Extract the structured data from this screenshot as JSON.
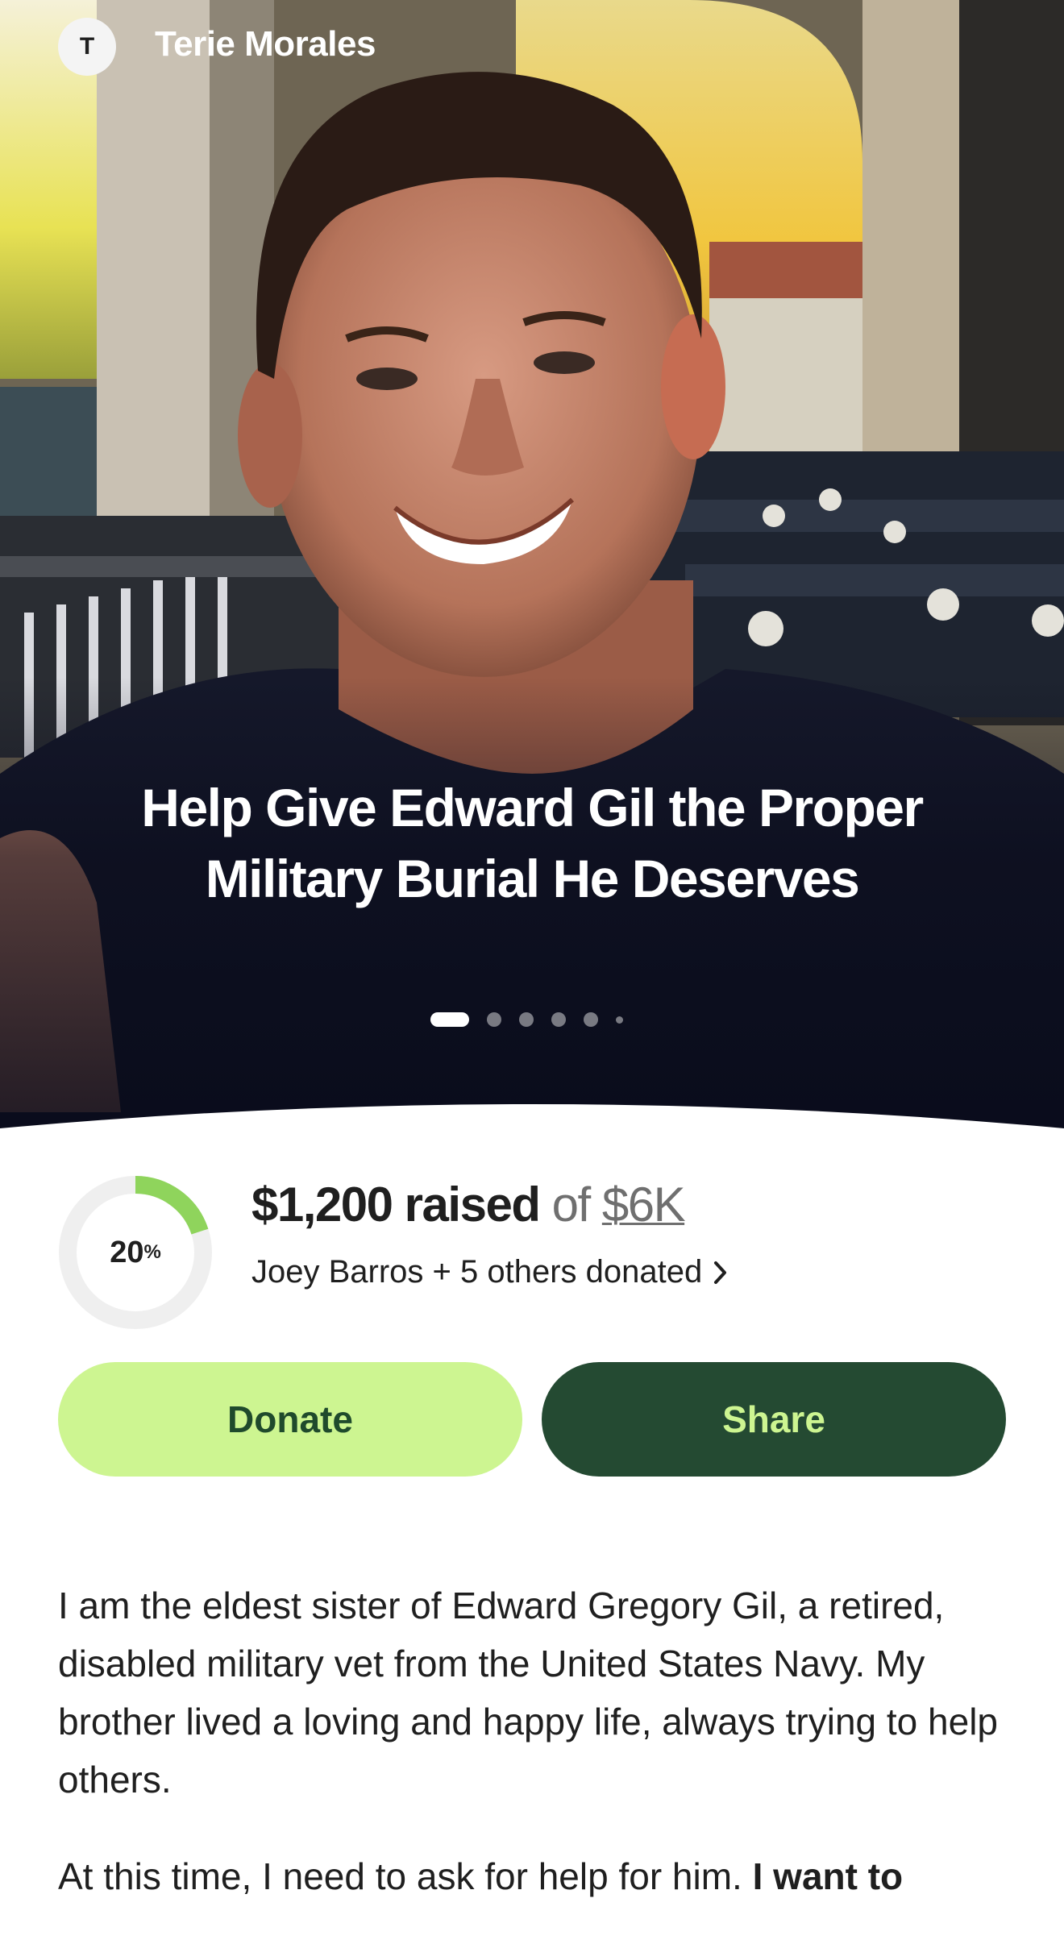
{
  "header": {
    "avatar_initial": "T",
    "organizer_name": "Terie Morales"
  },
  "hero": {
    "title": "Help Give Edward Gil the Proper Military Burial He Deserves",
    "photo_count": 6,
    "active_photo": 1
  },
  "progress": {
    "percent_value": "20",
    "percent_sign": "%",
    "fraction": 0.2,
    "raised_amount": "$1,200 raised",
    "of_text": "of",
    "goal": "$6K",
    "donors_text": "Joey Barros + 5 others donated"
  },
  "actions": {
    "donate_label": "Donate",
    "share_label": "Share"
  },
  "story": {
    "paragraph1": "I am the eldest sister of Edward Gregory Gil, a retired, disabled military vet from the United States Navy. My brother lived a loving and happy life, always trying to help others.",
    "paragraph2_start": "At this time, I need to ask for help for him.",
    "paragraph2_bold": "I want to"
  },
  "colors": {
    "donate_bg": "#cdf591",
    "share_bg": "#244a32",
    "progress_fill": "#8fd45c",
    "progress_track": "#efefef"
  }
}
